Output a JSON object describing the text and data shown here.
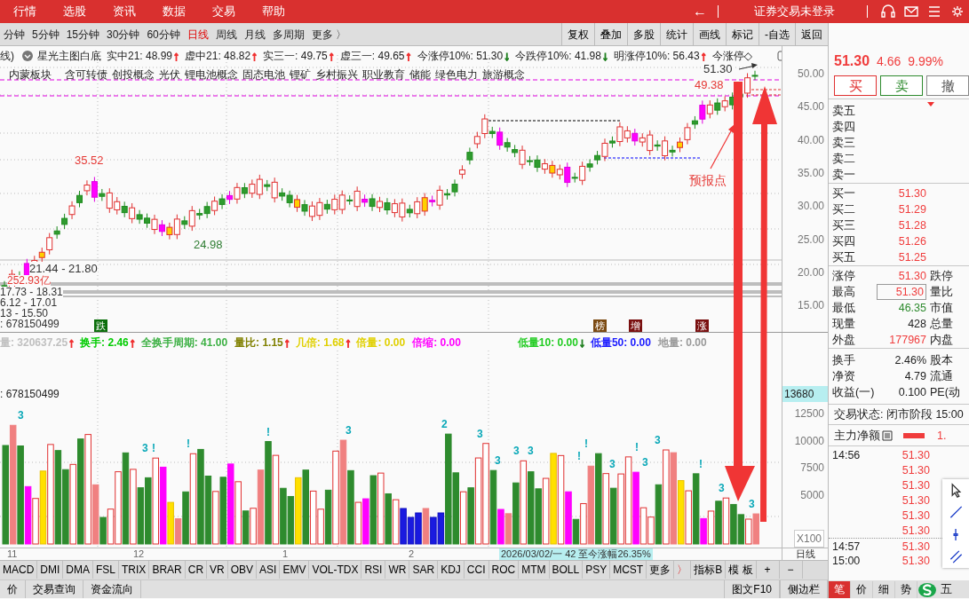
{
  "menu": {
    "items": [
      "行情",
      "选股",
      "资讯",
      "数据",
      "交易",
      "帮助"
    ],
    "back": "←",
    "login": "证券交易未登录"
  },
  "periods": [
    {
      "label": "分钟",
      "selected": false
    },
    {
      "label": "5分钟",
      "selected": false
    },
    {
      "label": "15分钟",
      "selected": false
    },
    {
      "label": "30分钟",
      "selected": false
    },
    {
      "label": "60分钟",
      "selected": false
    },
    {
      "label": "日线",
      "selected": true
    },
    {
      "label": "周线",
      "selected": false
    },
    {
      "label": "月线",
      "selected": false
    },
    {
      "label": "多周期",
      "selected": false
    },
    {
      "label": "更多 〉",
      "selected": false
    }
  ],
  "tools": [
    "复权",
    "叠加",
    "多股",
    "统计",
    "画线",
    "标记",
    "-自选",
    "返回"
  ],
  "price_pane": {
    "prefix": "线)",
    "formula": "星光主图白底",
    "indicators": [
      {
        "label": "实中21: 48.99",
        "arrow": {
          "glyph": "↑",
          "color": "#f03030"
        }
      },
      {
        "label": "虚中21: 48.82",
        "arrow": {
          "glyph": "↑",
          "color": "#f03030"
        }
      },
      {
        "label": "实三一: 49.75",
        "arrow": {
          "glyph": "↑",
          "color": "#f03030"
        }
      },
      {
        "label": "虚三一: 49.65",
        "arrow": {
          "glyph": "↑",
          "color": "#f03030"
        }
      },
      {
        "label": "今涨停10%: 51.30",
        "arrow": {
          "glyph": "↓",
          "color": "#208020"
        }
      },
      {
        "label": "今跌停10%: 41.98",
        "arrow": {
          "glyph": "↓",
          "color": "#208020"
        }
      },
      {
        "label": "明涨停10%: 56.43",
        "arrow": {
          "glyph": "↑",
          "color": "#f03030"
        }
      },
      {
        "label": "今涨停◇"
      }
    ],
    "concepts": [
      "内蒙板块",
      "含可转债",
      "创投概念",
      "光伏",
      "锂电池概念",
      "固态电池",
      "锂矿",
      "乡村振兴",
      "职业教育",
      "储能",
      "绿色电力",
      "旅游概念"
    ],
    "annotations": [
      {
        "text": "35.52",
        "color": "#e53935"
      },
      {
        "text": "24.98",
        "color": "#2e7d32"
      },
      {
        "text": "49.38",
        "color": "#e53935"
      },
      {
        "text": "51.30",
        "color": "#333333"
      },
      {
        "text": "21.44 - 21.80",
        "color": "#333333"
      },
      {
        "text": "252.93亿",
        "color": "#e53935"
      },
      {
        "text": "17.73 - 18.31",
        "color": "#333333"
      },
      {
        "text": "6.12 - 17.01",
        "color": "#333333"
      },
      {
        "text": "13 - 15.50",
        "color": "#333333"
      },
      {
        "text": ": 678150499",
        "color": "#333333"
      }
    ],
    "signals": [
      {
        "text": "跌",
        "color": "#0b6e0b"
      },
      {
        "text": "榜",
        "color": "#7b4a12"
      },
      {
        "text": "增",
        "color": "#7a1010"
      },
      {
        "text": "涨",
        "color": "#7a1010"
      }
    ],
    "callout": "预报点",
    "yticks": [
      "50.00",
      "45.00",
      "40.00",
      "35.00",
      "30.00",
      "25.00",
      "20.00",
      "15.00"
    ]
  },
  "volume_pane": {
    "indicators": [
      {
        "label": "量: 320637.25",
        "color": "#c0c0c0",
        "arrow": {
          "glyph": "↑",
          "color": "#f03030"
        }
      },
      {
        "label": "换手: 2.46",
        "color": "#00cc00",
        "arrow": {
          "glyph": "↑",
          "color": "#f03030"
        }
      },
      {
        "label": "全换手周期: 41.00",
        "color": "#3cb043"
      },
      {
        "label": "量比: 1.15",
        "color": "#808000",
        "arrow": {
          "glyph": "↑",
          "color": "#f03030"
        }
      },
      {
        "label": "几倍: 1.68",
        "color": "#e0d000",
        "arrow": {
          "glyph": "↑",
          "color": "#f03030"
        }
      },
      {
        "label": "倍量: 0.00",
        "color": "#e0d000"
      },
      {
        "label": "倍缩: 0.00",
        "color": "#ff00ff"
      },
      {
        "label": "低量10: 0.00",
        "color": "#22cc22",
        "arrow": {
          "glyph": "↓",
          "color": "#208020"
        }
      },
      {
        "label": "低量50: 0.00",
        "color": "#1a1aff"
      },
      {
        "label": "地量: 0.00",
        "color": "#999999"
      }
    ],
    "total": ": 678150499",
    "marks": [
      "3",
      "3",
      "!",
      "!",
      "!",
      "3",
      "2",
      "3",
      "3",
      "3",
      "3",
      "!",
      "!",
      "3",
      "!",
      "3",
      "3",
      "!",
      "3",
      "3"
    ],
    "current": "13680",
    "yticks": [
      "12500",
      "10000",
      "7500",
      "5000"
    ],
    "unit": "X100"
  },
  "date_axis": {
    "months": [
      "11",
      "12",
      "1",
      "2"
    ],
    "info": "2026/03/02/一 42 至今涨幅26.35%",
    "period": "日线"
  },
  "indicator_tabs": [
    "MACD",
    "DMI",
    "DMA",
    "FSL",
    "TRIX",
    "BRAR",
    "CR",
    "VR",
    "OBV",
    "ASI",
    "EMV",
    "VOL-TDX",
    "RSI",
    "WR",
    "SAR",
    "KDJ",
    "CCI",
    "ROC",
    "MTM",
    "BOLL",
    "PSY",
    "MCST"
  ],
  "more": "更多",
  "more_arrow": "〉",
  "extra_tabs": [
    "指标B",
    "模 板"
  ],
  "zoom": [
    "+",
    "−"
  ],
  "bottom_tabs": [
    "价",
    "交易查询",
    "资金流向"
  ],
  "bottom_right": [
    "图文F10",
    "侧边栏"
  ],
  "quote": {
    "price": "51.30",
    "change": "4.66",
    "pct": "9.99%",
    "buttons": [
      {
        "label": "买",
        "kind": "buy"
      },
      {
        "label": "卖",
        "kind": "sell"
      },
      {
        "label": "撤",
        "kind": "cancel"
      }
    ],
    "asks": [
      "卖五",
      "卖四",
      "卖三",
      "卖二",
      "卖一"
    ],
    "bids": [
      {
        "label": "买一",
        "price": "51.30"
      },
      {
        "label": "买二",
        "price": "51.29"
      },
      {
        "label": "买三",
        "price": "51.28"
      },
      {
        "label": "买四",
        "price": "51.26"
      },
      {
        "label": "买五",
        "price": "51.25"
      }
    ],
    "stats": [
      {
        "label": "涨停",
        "value": "51.30",
        "color": "#f03c3c",
        "label2": "跌停",
        "boxed": false
      },
      {
        "label": "最高",
        "value": "51.30",
        "color": "#f03c3c",
        "label2": "量比",
        "boxed": true
      },
      {
        "label": "最低",
        "value": "46.35",
        "color": "#2e8b2e",
        "label2": "市值",
        "boxed": false
      },
      {
        "label": "现量",
        "value": "428",
        "color": "#222222",
        "label2": "总量",
        "boxed": false
      },
      {
        "label": "外盘",
        "value": "177967",
        "color": "#f03c3c",
        "label2": "内盘",
        "boxed": false
      }
    ],
    "fundamentals": [
      {
        "label": "换手",
        "value": "2.46%",
        "label2": "股本"
      },
      {
        "label": "净资",
        "value": "4.79",
        "label2": "流通"
      },
      {
        "label": "收益(一)",
        "value": "0.100",
        "label2": "PE(动"
      }
    ],
    "status": "交易状态: 闭市阶段 15:00",
    "flow_label": "主力净额",
    "flow_value": "1.",
    "ticks": [
      {
        "time": "14:56",
        "price": "51.30"
      },
      {
        "price": "51.30"
      },
      {
        "price": "51.30"
      },
      {
        "price": "51.30"
      },
      {
        "price": "51.30"
      },
      {
        "price": "51.30"
      },
      {
        "time": "14:57",
        "price": "51.30"
      },
      {
        "time": "15:00",
        "price": "51.30"
      }
    ],
    "tabs": [
      {
        "label": "笔",
        "selected": true
      },
      {
        "label": "价",
        "selected": false
      },
      {
        "label": "细",
        "selected": false
      },
      {
        "label": "势",
        "selected": false
      }
    ],
    "extra": "五"
  }
}
